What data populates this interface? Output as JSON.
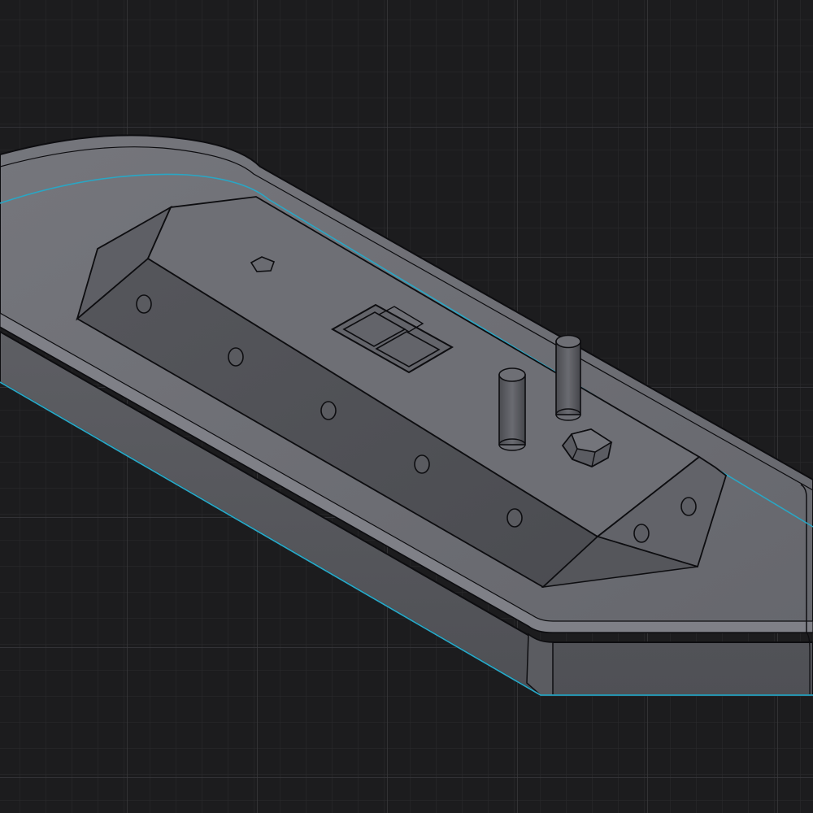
{
  "viewport": {
    "background": "#1c1c1e",
    "grid_minor_color": "#2b2b2e",
    "grid_major_color": "#3a3a3e",
    "selection_edge_color": "#2aa6c4",
    "model_edge_color": "#0d0d10"
  },
  "model": {
    "top_face_color": "#6c6d73",
    "side_face_color": "#56575c",
    "bevel_color": "#7d7e85",
    "cabin_top_color": "#6d6e74",
    "cabin_side_color": "#4e4f54",
    "cabin_end_color": "#5e5f65",
    "detail_color": "#5a5b61"
  }
}
